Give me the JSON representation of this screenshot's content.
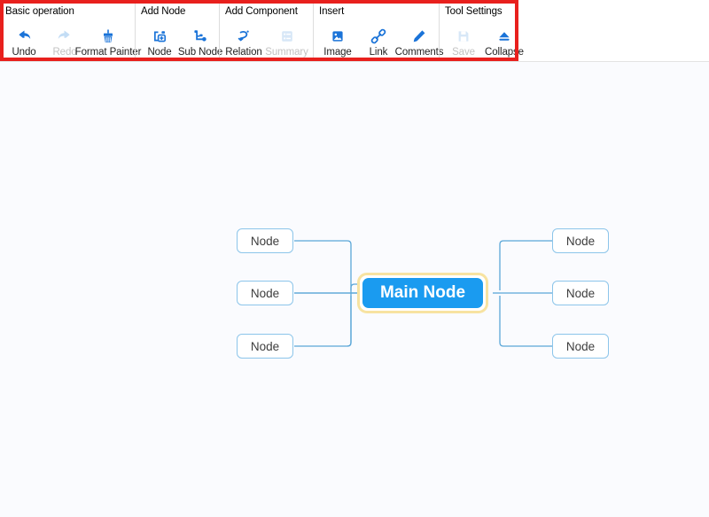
{
  "toolbar": {
    "groups": [
      {
        "label": "Basic operation",
        "items": [
          {
            "label": "Undo",
            "icon": "undo-icon",
            "disabled": false
          },
          {
            "label": "Redo",
            "icon": "redo-icon",
            "disabled": true
          },
          {
            "label": "Format Painter",
            "icon": "format-painter-icon",
            "disabled": false
          }
        ]
      },
      {
        "label": "Add Node",
        "items": [
          {
            "label": "Node",
            "icon": "add-node-icon",
            "disabled": false
          },
          {
            "label": "Sub Node",
            "icon": "add-sub-node-icon",
            "disabled": false
          }
        ]
      },
      {
        "label": "Add Component",
        "items": [
          {
            "label": "Relation",
            "icon": "relation-icon",
            "disabled": false
          },
          {
            "label": "Summary",
            "icon": "summary-icon",
            "disabled": true
          }
        ]
      },
      {
        "label": "Insert",
        "items": [
          {
            "label": "Image",
            "icon": "image-icon",
            "disabled": false
          },
          {
            "label": "Link",
            "icon": "link-icon",
            "disabled": false
          },
          {
            "label": "Comments",
            "icon": "comments-icon",
            "disabled": false
          }
        ]
      },
      {
        "label": "Tool Settings",
        "items": [
          {
            "label": "Save",
            "icon": "save-icon",
            "disabled": true
          },
          {
            "label": "Collapse",
            "icon": "collapse-icon",
            "disabled": false
          }
        ]
      }
    ]
  },
  "annotation": {
    "name": "red-highlight-rectangle",
    "color": "#e8201d"
  },
  "mindmap": {
    "main_node": {
      "label": "Main Node",
      "fill": "#1a9bf0",
      "selection_color": "#f7e3a1"
    },
    "left_children": [
      {
        "label": "Node"
      },
      {
        "label": "Node"
      },
      {
        "label": "Node"
      }
    ],
    "right_children": [
      {
        "label": "Node"
      },
      {
        "label": "Node"
      },
      {
        "label": "Node"
      }
    ],
    "connector_color": "#5ba7d8",
    "node_border_color": "#8cc5ea",
    "canvas_background": "#fafbfe"
  }
}
